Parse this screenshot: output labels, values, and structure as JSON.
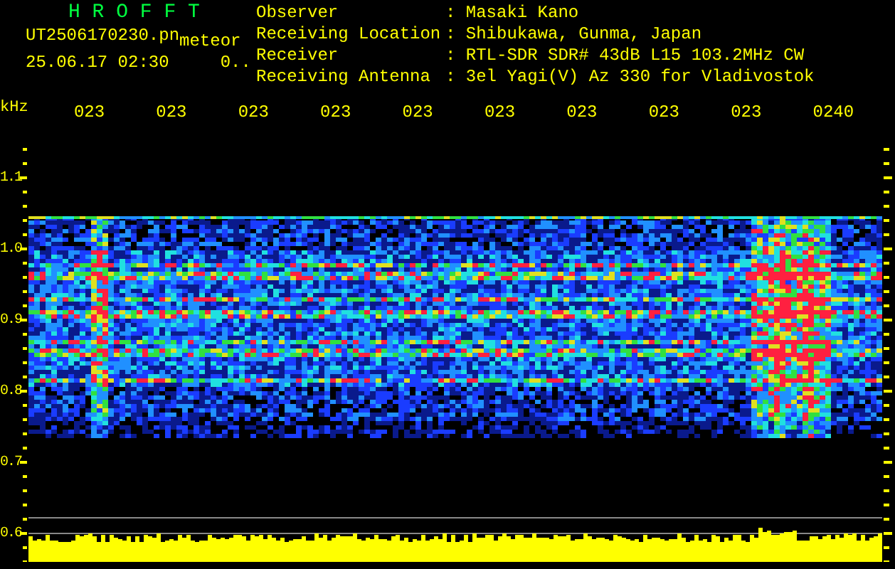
{
  "header": {
    "title": "H R O F F T",
    "file_name": "UT2506170230.pn",
    "mode": "meteor",
    "timestamp": "25.06.17 02:30",
    "count": "0.."
  },
  "station_info": [
    {
      "label": "Observer",
      "value": ": Masaki Kano"
    },
    {
      "label": "Receiving Location",
      "value": ": Shibukawa, Gunma, Japan"
    },
    {
      "label": "Receiver",
      "value": ": RTL-SDR SDR# 43dB L15 103.2MHz CW"
    },
    {
      "label": "Receiving Antenna",
      "value": ": 3el Yagi(V) Az 330 for Vladivostok"
    }
  ],
  "x_axis": {
    "labels": [
      "023",
      "023",
      "023",
      "023",
      "023",
      "023",
      "023",
      "023",
      "023",
      "0240"
    ]
  },
  "y_axis": {
    "unit": "kHz",
    "labels": [
      "1.1",
      "1.0",
      "0.9",
      "0.8",
      "0.7",
      "0.6"
    ]
  }
}
